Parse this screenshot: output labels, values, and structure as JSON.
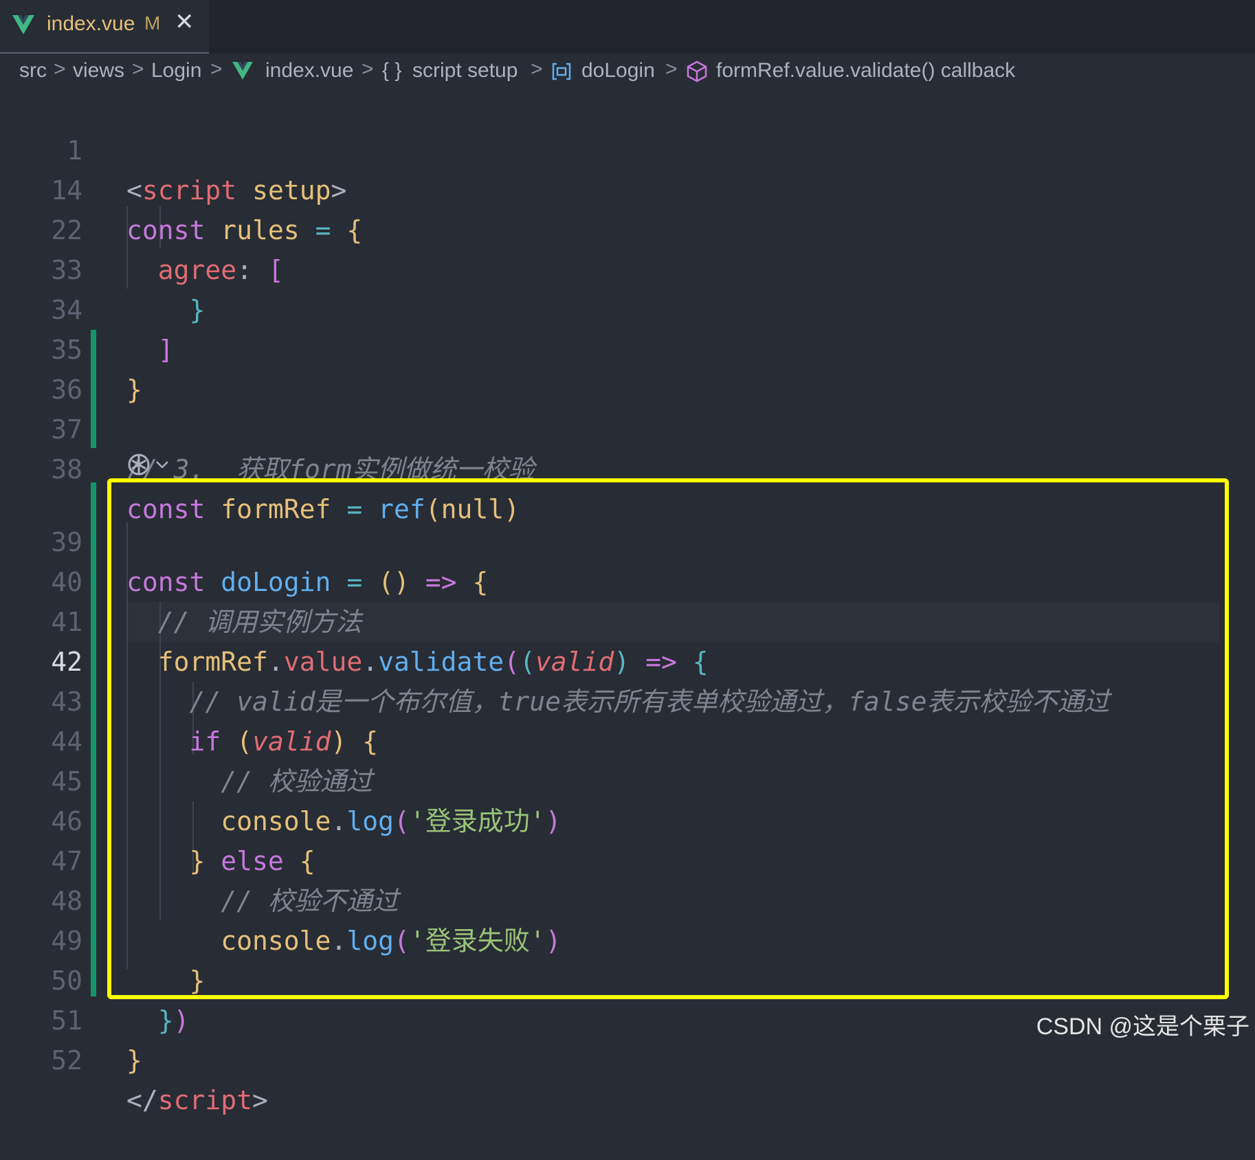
{
  "tab": {
    "title": "index.vue",
    "status": "M",
    "close_glyph": "✕",
    "icon": "vue-icon"
  },
  "breadcrumb": {
    "items": [
      "src",
      "views",
      "Login",
      "index.vue",
      "script setup",
      "doLogin",
      "formRef.value.validate() callback"
    ],
    "separator": ">",
    "symbol_braces": "{ }",
    "icons": [
      "vue-icon",
      "braces-icon",
      "method-icon",
      "cube-icon"
    ]
  },
  "lines": [
    {
      "num": "1",
      "tokens": [
        "<",
        "script",
        " ",
        "setup",
        ">"
      ]
    },
    {
      "num": "14",
      "tokens": [
        "const",
        " ",
        "rules",
        " ",
        "=",
        " ",
        "{"
      ]
    },
    {
      "num": "22",
      "tokens": [
        "agree",
        ":",
        " ",
        "["
      ]
    },
    {
      "num": "33",
      "tokens": [
        "}"
      ]
    },
    {
      "num": "34",
      "tokens": [
        "]"
      ]
    },
    {
      "num": "35",
      "tokens": [
        "}"
      ]
    },
    {
      "num": "36",
      "tokens": []
    },
    {
      "num": "37",
      "tokens": [
        "// 3.  获取form实例做统一校验"
      ]
    },
    {
      "num": "38",
      "tokens": [
        "const",
        " ",
        "formRef",
        " ",
        "=",
        " ",
        "ref",
        "(",
        "null",
        ")"
      ]
    },
    {
      "num": "39",
      "tokens": [
        "const",
        " ",
        "doLogin",
        " ",
        "=",
        " ",
        "(",
        ")",
        " ",
        "=>",
        " ",
        "{"
      ]
    },
    {
      "num": "40",
      "tokens": [
        "// 调用实例方法"
      ]
    },
    {
      "num": "41",
      "tokens": [
        "formRef",
        ".",
        "value",
        ".",
        "validate",
        "(",
        "(",
        "valid",
        ")",
        " ",
        "=>",
        " ",
        "{"
      ]
    },
    {
      "num": "42",
      "tokens": [
        "// valid是一个布尔值，true表示所有表单校验通过，false表示校验不通过"
      ]
    },
    {
      "num": "43",
      "tokens": [
        "if",
        " ",
        "(",
        "valid",
        ")",
        " ",
        "{"
      ]
    },
    {
      "num": "44",
      "tokens": [
        "// 校验通过"
      ]
    },
    {
      "num": "45",
      "tokens": [
        "console",
        ".",
        "log",
        "(",
        "'登录成功'",
        ")"
      ]
    },
    {
      "num": "46",
      "tokens": [
        "}",
        " ",
        "else",
        " ",
        "{"
      ]
    },
    {
      "num": "47",
      "tokens": [
        "// 校验不通过"
      ]
    },
    {
      "num": "48",
      "tokens": [
        "console",
        ".",
        "log",
        "(",
        "'登录失败'",
        ")"
      ]
    },
    {
      "num": "49",
      "tokens": [
        "}"
      ]
    },
    {
      "num": "50",
      "tokens": [
        "}",
        ")"
      ]
    },
    {
      "num": "51",
      "tokens": [
        "}"
      ]
    },
    {
      "num": "52",
      "tokens": [
        "</",
        "script",
        ">"
      ]
    }
  ],
  "active_line": "42",
  "codelens": {
    "icon": "copilot-icon",
    "chevron": "chevron-down-icon"
  },
  "colors": {
    "background": "#282c34",
    "tabbar": "#21252b",
    "keyword": "#c678dd",
    "variable": "#e5c07b",
    "function": "#61afef",
    "string": "#98c379",
    "comment": "#7f848e",
    "tag": "#e06c75",
    "highlight_box": "#ffff00",
    "git_added": "#109868"
  },
  "watermark": "CSDN @这是个栗子"
}
